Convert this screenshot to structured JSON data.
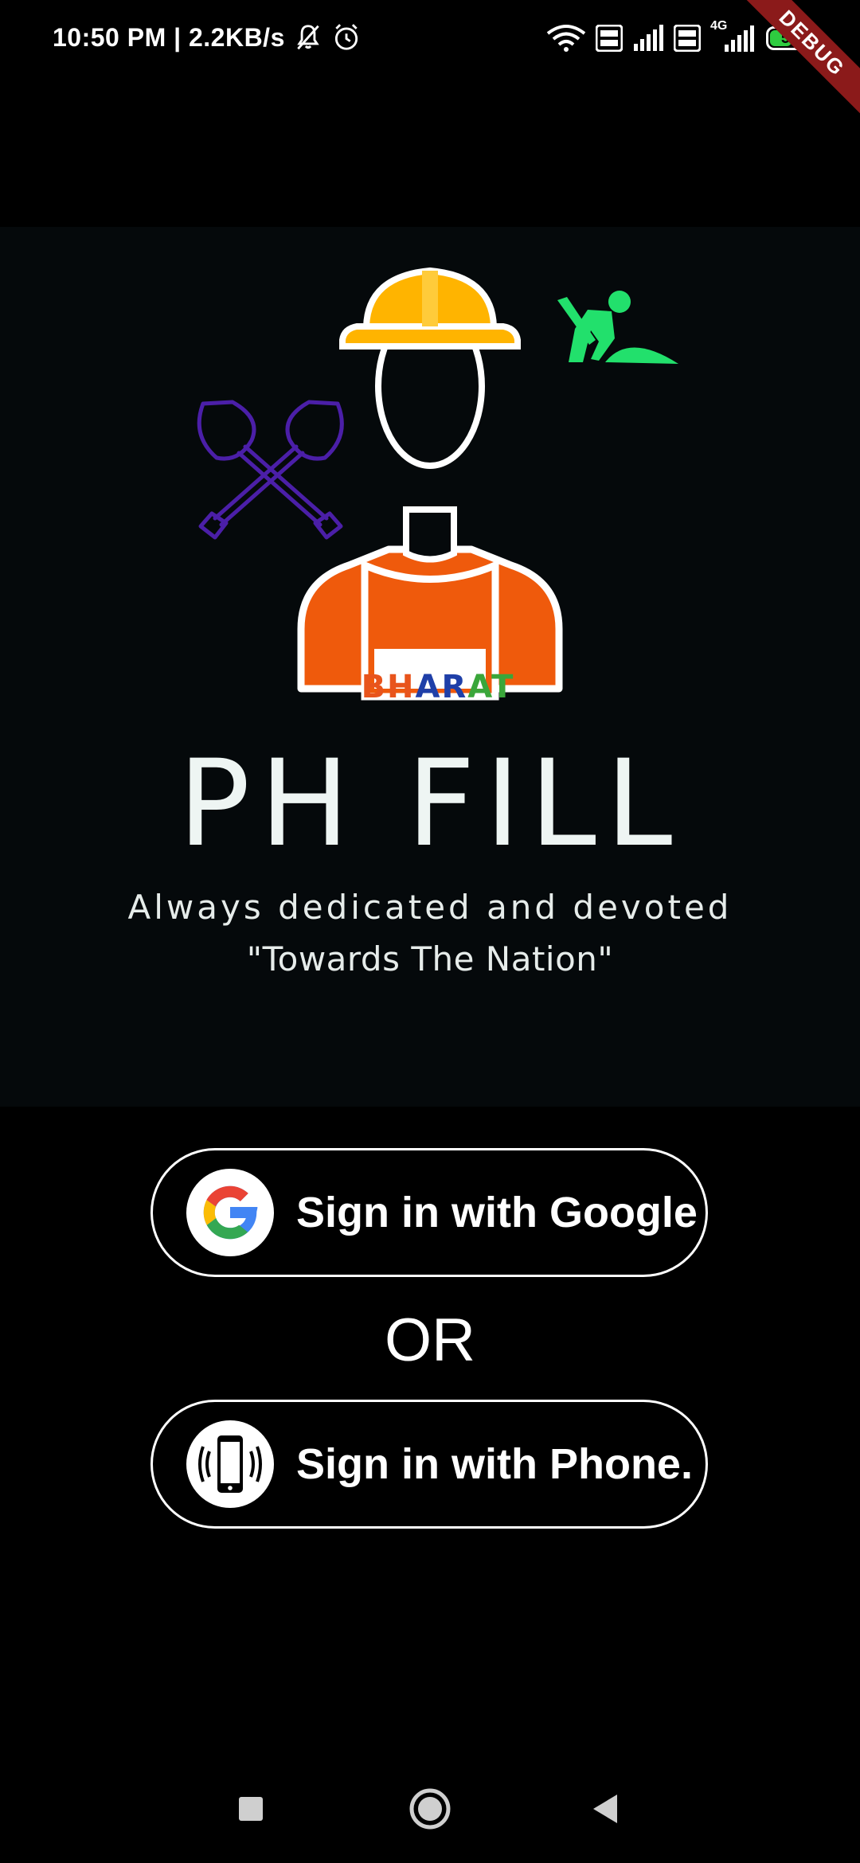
{
  "status_bar": {
    "time_speed": "10:50 PM | 2.2KB/s",
    "icons": [
      "mute-bell-icon",
      "alarm-icon",
      "wifi-icon",
      "volte-icon",
      "signal-icon",
      "volte-icon",
      "4g-signal-icon",
      "battery-icon"
    ],
    "network_type": "4G",
    "battery_level": "57",
    "battery_color": "#2ecc40"
  },
  "debug_banner": "DEBUG",
  "logo": {
    "badge_text_parts": [
      {
        "text": "BH",
        "color": "#e8541c"
      },
      {
        "text": "AR",
        "color": "#1f3fa8"
      },
      {
        "text": "AT",
        "color": "#3aa63a"
      }
    ],
    "title": "PH FILL",
    "tagline": "Always dedicated and devoted",
    "quote": "\"Towards The Nation\"",
    "colors": {
      "helmet": "#ffb400",
      "shirt": "#ef5a0c",
      "shovels": "#4b1fa8",
      "worker_icon": "#22e06c"
    }
  },
  "auth": {
    "google_button_label": "Sign in with Google",
    "or_label": "OR",
    "phone_button_label": "Sign in with Phone."
  },
  "nav_bar": {
    "icons": [
      "recents-square-icon",
      "home-circle-icon",
      "back-triangle-icon"
    ]
  }
}
